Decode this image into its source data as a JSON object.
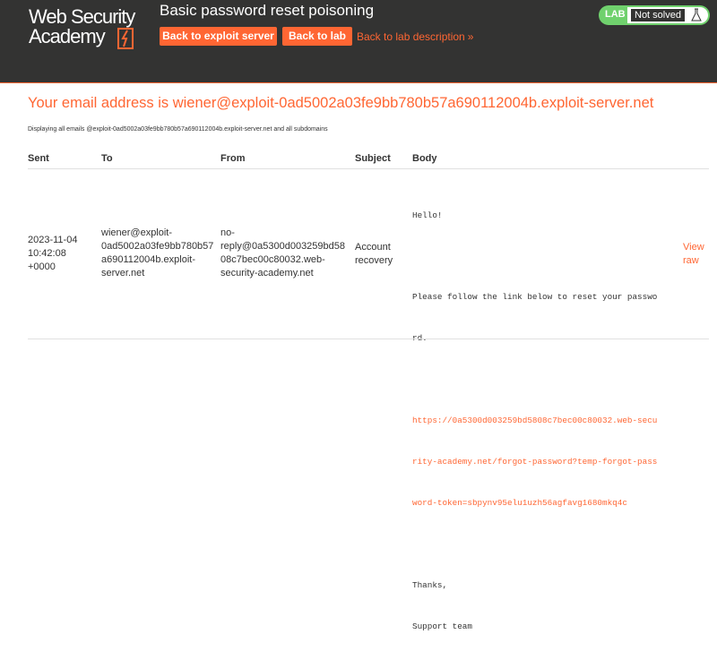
{
  "header": {
    "logo_line1": "Web Security",
    "logo_line2": "Academy",
    "lab_title": "Basic password reset poisoning",
    "back_exploit_label": "Back to exploit server",
    "back_lab_label": "Back to lab",
    "lab_description_label": "Back to lab description",
    "lab_badge": "LAB",
    "lab_state": "Not solved",
    "colors": {
      "accent": "#ff6633",
      "header_bg": "#333332",
      "status_green": "#70d16d"
    }
  },
  "main": {
    "email_title": "Your email address is wiener@exploit-0ad5002a03fe9bb780b57a690112004b.exploit-server.net",
    "display_note": "Displaying all emails @exploit-0ad5002a03fe9bb780b57a690112004b.exploit-server.net and all subdomains",
    "columns": [
      "Sent",
      "To",
      "From",
      "Subject",
      "Body"
    ],
    "emails": [
      {
        "sent": [
          "2023-11-04",
          "10:42:08",
          "+0000"
        ],
        "to": [
          "wiener@exploit-",
          "0ad5002a03fe9bb780b57",
          "a690112004b.exploit-",
          "server.net"
        ],
        "from": [
          "no-",
          "reply@0a5300d003259bd58",
          "08c7bec00c80032.web-",
          "security-academy.net"
        ],
        "subject": [
          "Account",
          "recovery"
        ],
        "body_lines": [
          "Hello!",
          "",
          "Please follow the link below to reset your passwo",
          "rd.",
          "",
          "https://0a5300d003259bd5808c7bec00c80032.web-secu",
          "rity-academy.net/forgot-password?temp-forgot-pass",
          "word-token=sbpynv95elu1uzh56agfavg1680mkq4c",
          "",
          "Thanks,",
          "Support team"
        ],
        "view_raw": [
          "View",
          "raw"
        ]
      }
    ]
  }
}
